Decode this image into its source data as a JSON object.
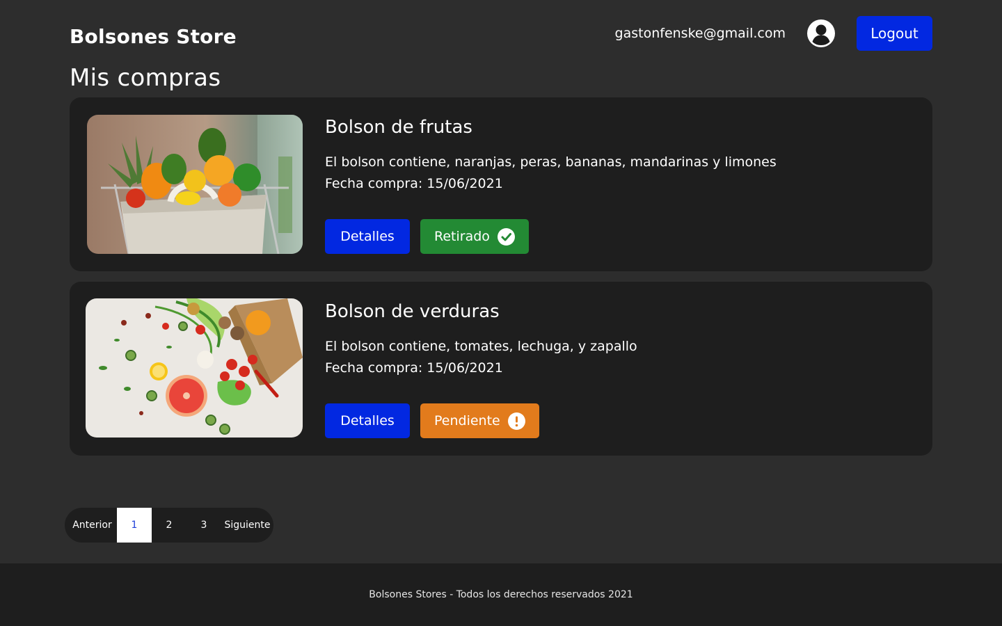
{
  "header": {
    "brand": "Bolsones Store",
    "email": "gastonfenske@gmail.com",
    "logout_label": "Logout",
    "user_icon": "user-circle-icon"
  },
  "page": {
    "title": "Mis compras"
  },
  "purchases": [
    {
      "title": "Bolson de frutas",
      "description": "El bolson contiene, naranjas, peras, bananas, mandarinas y limones",
      "date": "Fecha compra: 15/06/2021",
      "details_label": "Detalles",
      "status_label": "Retirado",
      "status_icon": "check-circle-icon",
      "status_color": "#238a34"
    },
    {
      "title": "Bolson de verduras",
      "description": "El bolson contiene, tomates, lechuga, y zapallo",
      "date": "Fecha compra: 15/06/2021",
      "details_label": "Detalles",
      "status_label": "Pendiente",
      "status_icon": "exclamation-circle-icon",
      "status_color": "#e27b1c"
    }
  ],
  "pagination": {
    "prev_label": "Anterior",
    "pages": [
      "1",
      "2",
      "3"
    ],
    "current": "1",
    "next_label": "Siguiente"
  },
  "footer": {
    "text": "Bolsones Stores - Todos los derechos reservados 2021"
  },
  "colors": {
    "background": "#2d2d2d",
    "card": "#1e1e1e",
    "primary": "#0228e1",
    "success": "#238a34",
    "warning": "#e27b1c"
  }
}
